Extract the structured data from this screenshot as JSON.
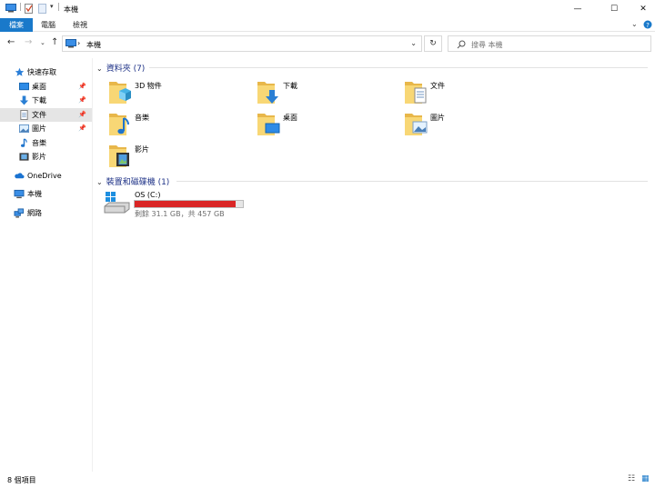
{
  "window": {
    "title": "本機"
  },
  "ribbon": {
    "tabs": [
      "檔案",
      "電腦",
      "檢視"
    ]
  },
  "address": {
    "location": "本機",
    "separator": "›"
  },
  "search": {
    "placeholder": "搜尋 本機"
  },
  "nav": {
    "quick_access": "快速存取",
    "items": [
      {
        "label": "桌面",
        "icon": "desktop-icon",
        "pinned": true
      },
      {
        "label": "下載",
        "icon": "download-icon",
        "pinned": true
      },
      {
        "label": "文件",
        "icon": "documents-icon",
        "pinned": true
      },
      {
        "label": "圖片",
        "icon": "pictures-icon",
        "pinned": true
      },
      {
        "label": "音樂",
        "icon": "music-icon",
        "pinned": false
      },
      {
        "label": "影片",
        "icon": "videos-icon",
        "pinned": false
      }
    ],
    "onedrive": "OneDrive",
    "this_pc": "本機",
    "network": "網路"
  },
  "folders": {
    "header": "資料夾 (7)",
    "items": [
      {
        "label": "3D 物件",
        "icon": "3d-objects-icon"
      },
      {
        "label": "下載",
        "icon": "downloads-folder-icon"
      },
      {
        "label": "文件",
        "icon": "documents-folder-icon"
      },
      {
        "label": "音樂",
        "icon": "music-folder-icon"
      },
      {
        "label": "桌面",
        "icon": "desktop-folder-icon"
      },
      {
        "label": "圖片",
        "icon": "pictures-folder-icon"
      },
      {
        "label": "影片",
        "icon": "videos-folder-icon"
      }
    ]
  },
  "devices": {
    "header": "裝置和磁碟機 (1)",
    "drive": {
      "name": "OS (C:)",
      "space": "剩餘 31.1 GB，共 457 GB",
      "used_fraction": 0.93,
      "bar_color": "#da2626"
    }
  },
  "status": {
    "count": "8 個項目"
  },
  "colors": {
    "accent": "#1979ca",
    "header": "#1e3287"
  }
}
